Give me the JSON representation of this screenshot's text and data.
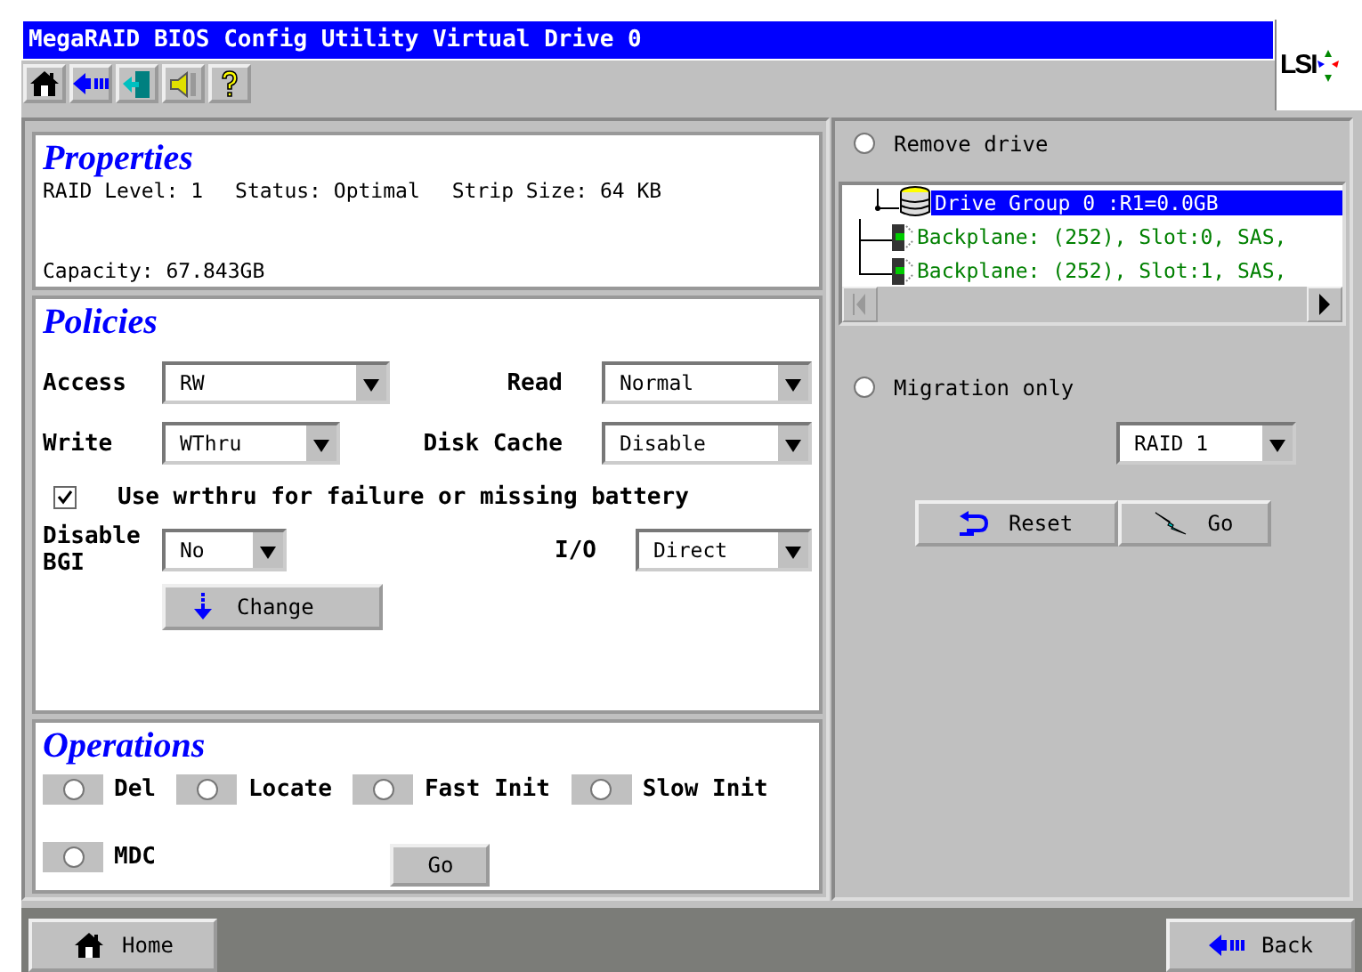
{
  "window": {
    "title": "MegaRAID BIOS Config Utility Virtual Drive 0",
    "logo": "LSI"
  },
  "properties": {
    "heading": "Properties",
    "fields": [
      "RAID Level: 1",
      "Status: Optimal",
      "Strip Size: 64 KB"
    ],
    "capacity": "Capacity: 67.843GB"
  },
  "policies": {
    "heading": "Policies",
    "dropdowns": [
      {
        "label": "Access",
        "value": "RW"
      },
      {
        "label": "Read",
        "value": "Normal"
      },
      {
        "label": "Write",
        "value": "WThru"
      },
      {
        "label": "Disk Cache",
        "value": "Disable"
      },
      {
        "label": "Disable BGI",
        "value": "No"
      },
      {
        "label": "I/O",
        "value": "Direct"
      }
    ],
    "checkbox": {
      "label": "Use wrthru for failure or missing battery",
      "checked": true
    },
    "button": "Change"
  },
  "operations": {
    "heading": "Operations",
    "options": [
      {
        "label": "Del",
        "selected": false
      },
      {
        "label": "Locate",
        "selected": false
      },
      {
        "label": "Fast Init",
        "selected": false
      },
      {
        "label": "Slow Init",
        "selected": false
      },
      {
        "label": "MDC",
        "selected": false
      }
    ],
    "button": "Go"
  },
  "right": {
    "remove": {
      "label": "Remove drive",
      "selected": false
    },
    "tree": {
      "label": "Drive Group 0 :R1=0.0GB",
      "selected": true,
      "children": [
        {
          "label": "Backplane: (252), Slot:0, SAS,"
        },
        {
          "label": "Backplane: (252), Slot:1, SAS,"
        }
      ]
    },
    "migration": {
      "label": "Migration only",
      "selected": false
    },
    "raid": "RAID 1",
    "buttons": [
      "Reset",
      "Go"
    ]
  },
  "footer": {
    "home": "Home",
    "back": "Back"
  }
}
